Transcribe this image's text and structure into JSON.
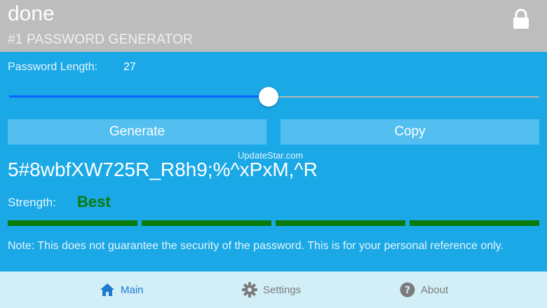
{
  "header": {
    "title": "done",
    "subtitle": "#1 PASSWORD GENERATOR",
    "lock_icon": "lock-icon"
  },
  "controls": {
    "length_label": "Password Length:",
    "length_value": "27",
    "slider_fraction": 0.49,
    "generate_label": "Generate",
    "copy_label": "Copy"
  },
  "watermark": "UpdateStar.com",
  "password": "5#8wbfXW725R_R8h9;%^xPxM,^R",
  "strength": {
    "label": "Strength:",
    "value": "Best",
    "bars_filled": 4,
    "bars_total": 4,
    "color": "#0a7a0a"
  },
  "note": "Note: This does not guarantee the security of the password. This is for your personal reference only.",
  "tabs": [
    {
      "label": "Main",
      "icon": "home-icon",
      "active": true
    },
    {
      "label": "Settings",
      "icon": "gear-icon",
      "active": false
    },
    {
      "label": "About",
      "icon": "question-icon",
      "active": false
    }
  ],
  "colors": {
    "accent": "#1aa8e6",
    "header_bg": "#bdbdbd",
    "slider_active": "#0a63ff",
    "tab_active": "#1f7ad0"
  }
}
